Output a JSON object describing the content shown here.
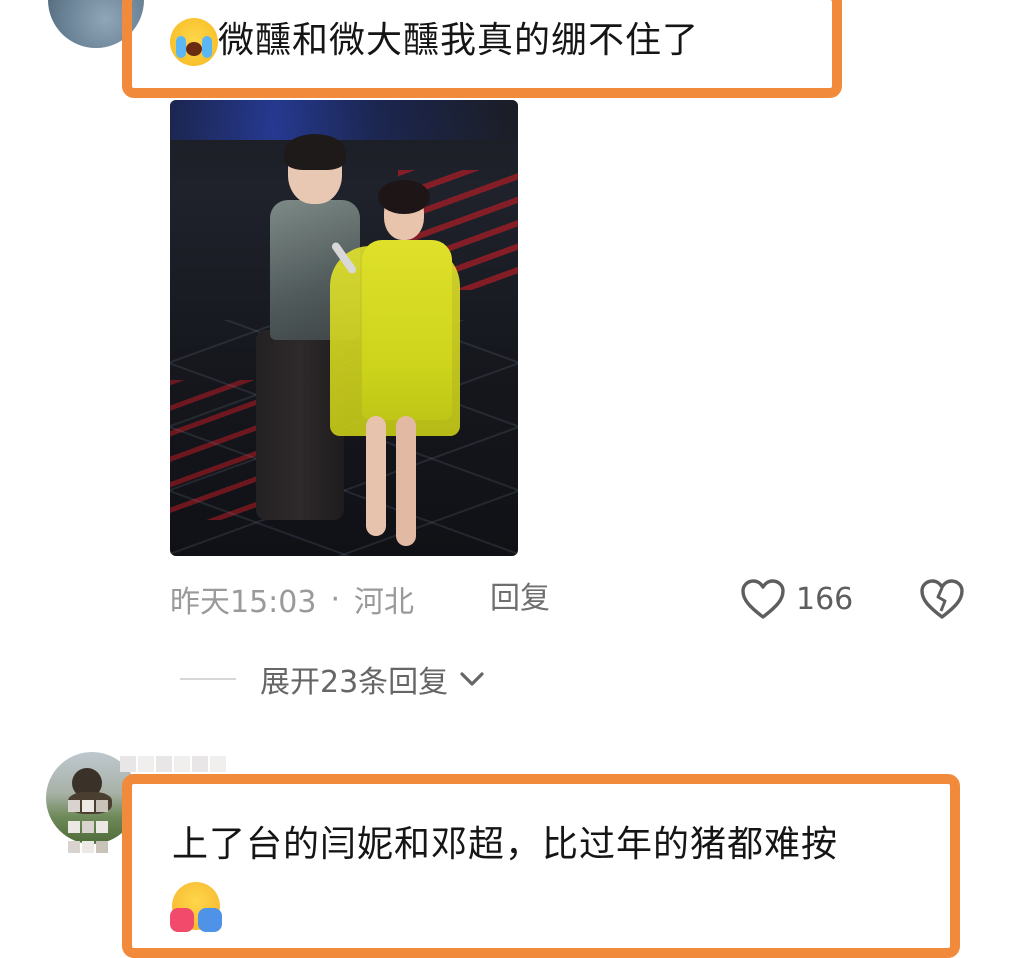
{
  "comment1": {
    "text": "微醺和微大醺我真的绷不住了",
    "emoji": "loudly-crying-face-emoji",
    "time": "昨天15:03",
    "separator": "·",
    "location": "河北",
    "reply_label": "回复",
    "like_count": "166",
    "expand_label": "展开23条回复"
  },
  "comment2": {
    "text": "上了台的闫妮和邓超，比过年的猪都难按",
    "emoji": "hugging-face-emoji"
  },
  "colors": {
    "highlight": "#f28a3b",
    "meta_text": "#9a9a9a"
  },
  "icons": {
    "like": "heart-outline-icon",
    "dislike": "broken-heart-icon",
    "expand": "chevron-down-icon"
  }
}
